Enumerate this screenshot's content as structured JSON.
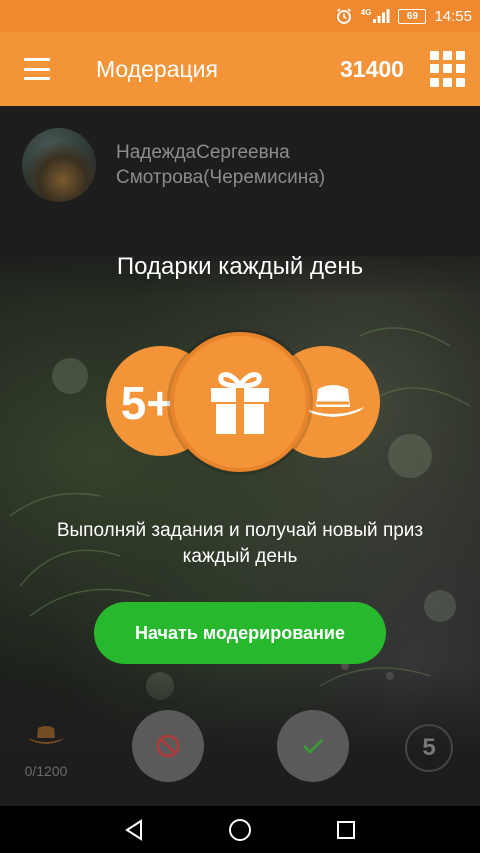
{
  "status_bar": {
    "network": "4G",
    "battery": "69",
    "time": "14:55"
  },
  "app_bar": {
    "title": "Модерация",
    "balance": "31400"
  },
  "profile": {
    "name_line1": "НадеждаСергеевна",
    "name_line2": "Смотрова(Черемисина)"
  },
  "promo": {
    "title": "Подарки каждый день",
    "gift_left_text": "5+",
    "description_line1": "Выполняй задания и получай новый приз",
    "description_line2": "каждый день",
    "button_label": "Начать модерирование"
  },
  "bottom": {
    "hat_count": "0/1200",
    "level": "5"
  },
  "icons": {
    "menu": "menu-icon",
    "apps": "apps-grid-icon",
    "gift": "gift-icon",
    "hat": "hat-icon",
    "reject": "block-icon",
    "approve": "check-icon"
  },
  "colors": {
    "accent": "#f39438",
    "status_bar": "#f0882f",
    "button_green": "#27b82e",
    "background": "#1d1d1d"
  }
}
